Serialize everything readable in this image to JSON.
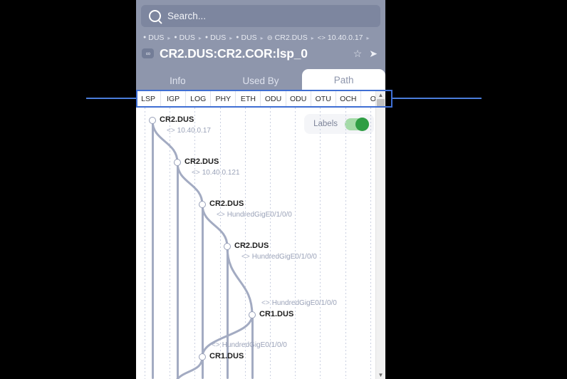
{
  "colors": {
    "header_bg": "#8e96ac",
    "accent_blue": "#3f6fd4",
    "toggle_green": "#2f9e44",
    "link_gray": "#9aa2b8"
  },
  "search": {
    "placeholder": "Search...",
    "icon": "search-icon"
  },
  "breadcrumb": [
    {
      "icon": "location-pin-icon",
      "label": "DUS"
    },
    {
      "icon": "location-pin-icon",
      "label": "DUS"
    },
    {
      "icon": "location-pin-icon",
      "label": "DUS"
    },
    {
      "icon": "location-pin-icon",
      "label": "DUS"
    },
    {
      "icon": "circle-minus-icon",
      "label": "CR2.DUS"
    },
    {
      "icon": "interface-arrows-icon",
      "label": "10.40.0.17"
    }
  ],
  "title": {
    "badge_icon": "link-chain-icon",
    "text": "CR2.DUS:CR2.COR:lsp_0",
    "star_icon": "star-outline-icon",
    "send_icon": "send-arrow-icon"
  },
  "tabs": [
    {
      "label": "Info",
      "active": false
    },
    {
      "label": "Used By",
      "active": false
    },
    {
      "label": "Path",
      "active": true
    }
  ],
  "subtabs": [
    "LSP",
    "IGP",
    "LOG",
    "PHY",
    "ETH",
    "ODU",
    "ODU",
    "OTU",
    "OCH",
    "O"
  ],
  "labels_toggle": {
    "label": "Labels",
    "on": true
  },
  "path": {
    "nodes": [
      {
        "name": "CR2.DUS",
        "iface": "10.40.0.17",
        "iface_above": false
      },
      {
        "name": "CR2.DUS",
        "iface": "10.40.0.121",
        "iface_above": false
      },
      {
        "name": "CR2.DUS",
        "iface": "HundredGigE0/1/0/0",
        "iface_above": false
      },
      {
        "name": "CR2.DUS",
        "iface": "HundredGigE0/1/0/0",
        "iface_above": false
      },
      {
        "name": "CR1.DUS",
        "iface": "HundredGigE0/1/0/0",
        "iface_above": true
      },
      {
        "name": "CR1.DUS",
        "iface": "HundredGigE0/1/0/0",
        "iface_above": true
      }
    ],
    "iface_arrow": "<>"
  },
  "scrollbar": {
    "up": "▲",
    "down": "▼"
  }
}
